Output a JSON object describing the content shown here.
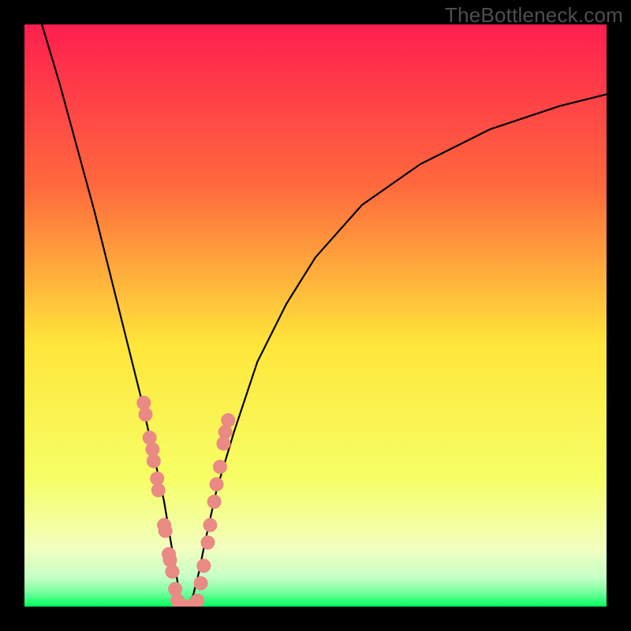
{
  "watermark": "TheBottleneck.com",
  "chart_data": {
    "type": "line",
    "title": "",
    "xlabel": "",
    "ylabel": "",
    "xlim": [
      0,
      100
    ],
    "ylim": [
      0,
      100
    ],
    "background_gradient": {
      "top": "#ff1f4f",
      "mid_upper": "#ff9a3a",
      "mid": "#ffe63a",
      "lower": "#f7ff8a",
      "band": "#d8ffc8",
      "bottom": "#00ff5c"
    },
    "curve": {
      "note": "V-shaped bottleneck curve; y=0 is the green optimum band, y=100 is worst (red).",
      "minimum_x": 27,
      "left_branch_x_range": [
        3,
        27
      ],
      "right_branch_x_range": [
        27,
        100
      ],
      "x": [
        3,
        6,
        9,
        12,
        15,
        18,
        20,
        22,
        24,
        25,
        26,
        27,
        28,
        29,
        30,
        31,
        33,
        36,
        40,
        45,
        50,
        58,
        68,
        80,
        92,
        100
      ],
      "y": [
        100,
        90,
        79,
        68,
        56,
        44,
        36,
        27,
        18,
        12,
        6,
        0,
        0,
        2,
        6,
        11,
        20,
        30,
        42,
        52,
        60,
        69,
        76,
        82,
        86,
        88
      ]
    },
    "highlight_points": {
      "note": "Salmon marker clusters near the valley on both branches (approximate positions).",
      "points": [
        {
          "x": 20.5,
          "y": 35
        },
        {
          "x": 20.8,
          "y": 33
        },
        {
          "x": 21.5,
          "y": 29
        },
        {
          "x": 22.0,
          "y": 27
        },
        {
          "x": 22.2,
          "y": 25
        },
        {
          "x": 22.8,
          "y": 22
        },
        {
          "x": 23.0,
          "y": 20
        },
        {
          "x": 24.0,
          "y": 14
        },
        {
          "x": 24.2,
          "y": 13
        },
        {
          "x": 24.8,
          "y": 9
        },
        {
          "x": 25.0,
          "y": 8
        },
        {
          "x": 25.4,
          "y": 6
        },
        {
          "x": 25.9,
          "y": 3
        },
        {
          "x": 26.3,
          "y": 1
        },
        {
          "x": 26.8,
          "y": 0
        },
        {
          "x": 27.5,
          "y": 0
        },
        {
          "x": 28.3,
          "y": 0
        },
        {
          "x": 29.0,
          "y": 0
        },
        {
          "x": 29.7,
          "y": 1
        },
        {
          "x": 30.3,
          "y": 4
        },
        {
          "x": 30.8,
          "y": 7
        },
        {
          "x": 31.5,
          "y": 11
        },
        {
          "x": 31.9,
          "y": 14
        },
        {
          "x": 32.6,
          "y": 18
        },
        {
          "x": 33.0,
          "y": 21
        },
        {
          "x": 33.6,
          "y": 24
        },
        {
          "x": 34.2,
          "y": 28
        },
        {
          "x": 34.5,
          "y": 30
        },
        {
          "x": 35.0,
          "y": 32
        }
      ],
      "color": "#e98a84",
      "radius_px": 9
    }
  }
}
